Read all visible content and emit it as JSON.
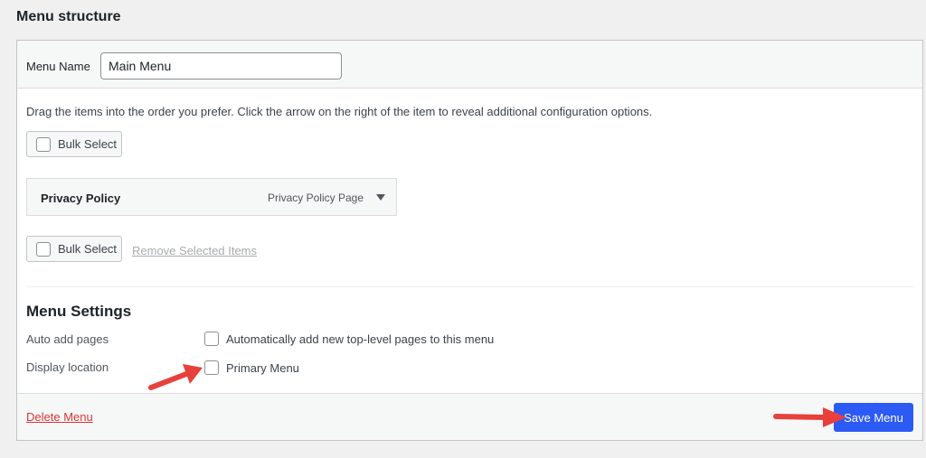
{
  "page": {
    "title": "Menu structure"
  },
  "menu_name": {
    "label": "Menu Name",
    "value": "Main Menu"
  },
  "instructions": "Drag the items into the order you prefer. Click the arrow on the right of the item to reveal additional configuration options.",
  "bulk_select_label": "Bulk Select",
  "menu_items": [
    {
      "title": "Privacy Policy",
      "type": "Privacy Policy Page"
    }
  ],
  "remove_selected_label": "Remove Selected Items",
  "settings": {
    "title": "Menu Settings",
    "auto_add": {
      "label": "Auto add pages",
      "option": "Automatically add new top-level pages to this menu",
      "checked": false
    },
    "display_location": {
      "label": "Display location",
      "option": "Primary Menu",
      "checked": false
    }
  },
  "footer": {
    "delete_label": "Delete Menu",
    "save_label": "Save Menu"
  },
  "colors": {
    "accent": "#2c5af5",
    "delete": "#d63638",
    "annotation_arrow": "#e8403a"
  }
}
